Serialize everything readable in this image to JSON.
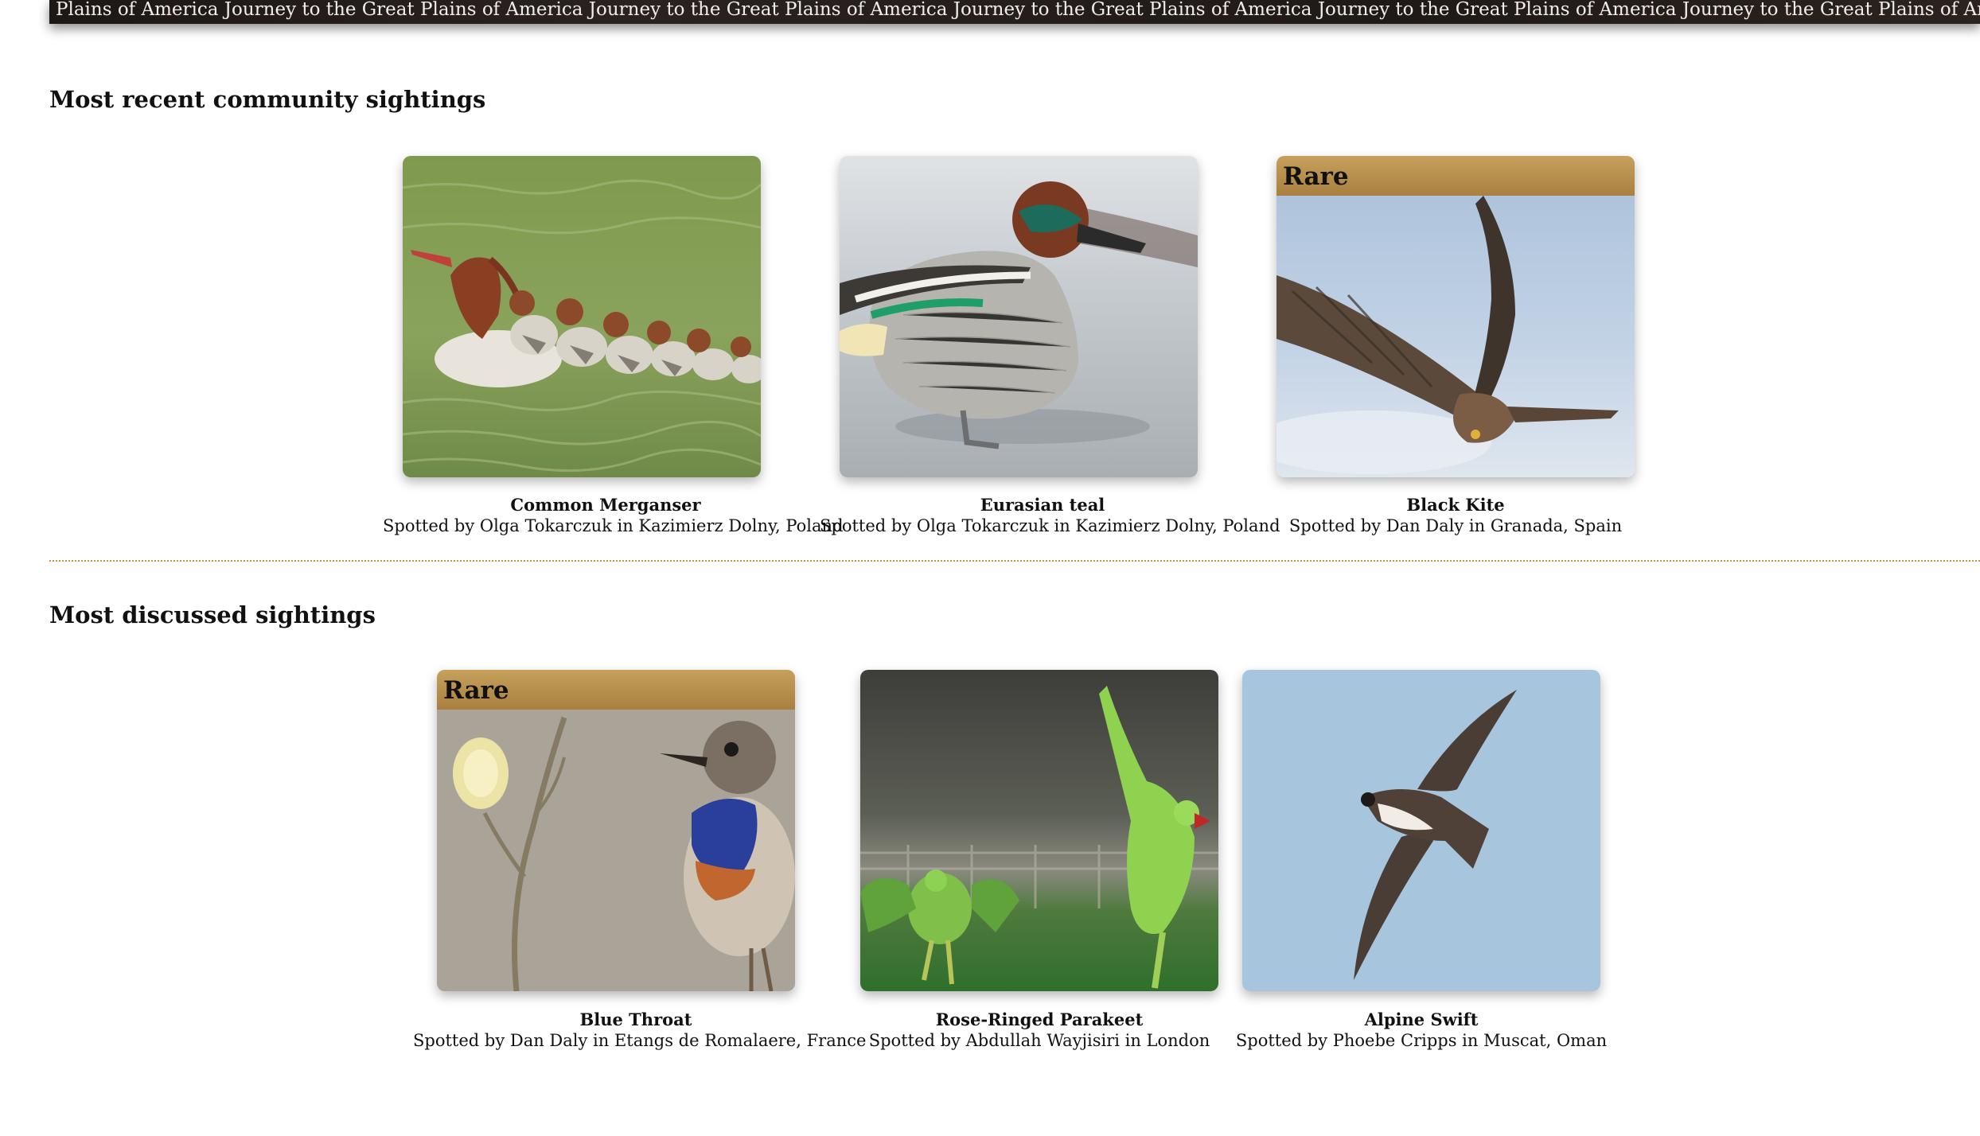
{
  "banner": {
    "text": "Plains of America Journey to the Great Plains of America Journey to the Great Plains of America Journey to the Great Plains of America Journey to the Great Plains of America Journey to the Great Plains of America Journey to the Great Plains of America."
  },
  "recent": {
    "title": "Most recent community sightings",
    "cards": [
      {
        "name": "Common Merganser",
        "subtitle": "Spotted by Olga Tokarczuk in Kazimierz Dolny, Poland",
        "image": "merganser-with-ducklings-photo"
      },
      {
        "name": "Eurasian teal",
        "subtitle": "Spotted by Olga Tokarczuk in Kazimierz Dolny, Poland",
        "image": "teal-duck-photo"
      },
      {
        "name": "Black Kite",
        "subtitle": "Spotted by Dan Daly in Granada, Spain",
        "badge": "Rare",
        "image": "kite-in-flight-photo"
      }
    ]
  },
  "discussed": {
    "title": "Most discussed sightings",
    "cards": [
      {
        "name": "Blue Throat",
        "subtitle": "Spotted by Dan Daly in Etangs de Romalaere, France",
        "badge": "Rare",
        "image": "bluethroat-photo"
      },
      {
        "name": "Rose-Ringed Parakeet",
        "subtitle": "Spotted by Abdullah Wayjisiri in London",
        "image": "parakeets-photo"
      },
      {
        "name": "Alpine Swift",
        "subtitle": "Spotted by Phoebe Cripps in Muscat, Oman",
        "image": "swift-photo"
      }
    ]
  },
  "colors": {
    "rare_badge": "#b89150",
    "divider": "#c9963a",
    "banner_bg": "#231c1a"
  }
}
